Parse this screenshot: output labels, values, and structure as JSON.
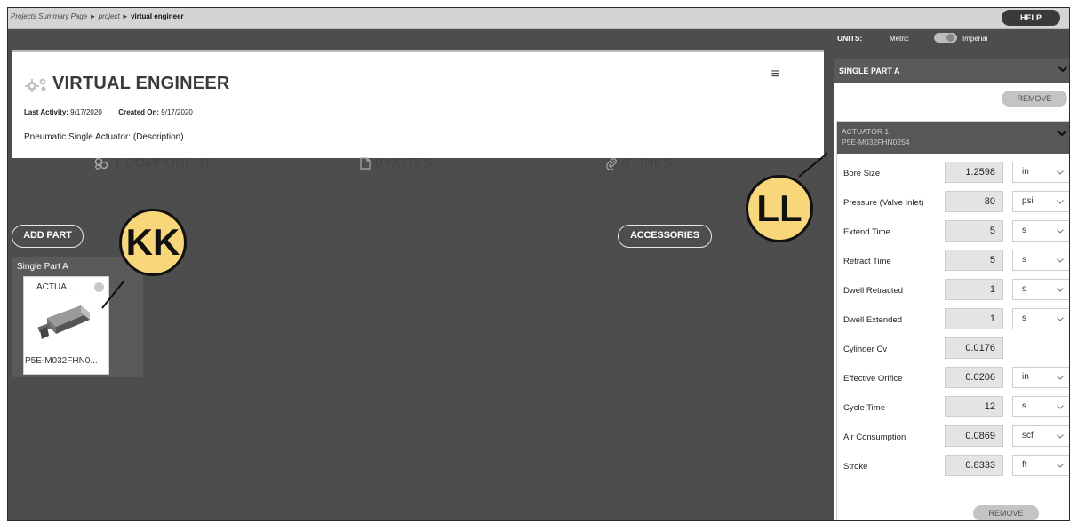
{
  "breadcrumb": {
    "link1": "Projects Summary Page",
    "sep": "►",
    "link2": "project",
    "current": "virtual engineer"
  },
  "help_label": "HELP",
  "project": {
    "title": "VIRTUAL ENGINEER",
    "last_activity_label": "Last Activity:",
    "last_activity": "9/17/2020",
    "created_label": "Created On:",
    "created": "9/17/2020",
    "description": "Pneumatic Single Actuator: (Description)",
    "components": "1 COMPONENT",
    "notes": "0 NOTES",
    "links": "0 LINKS",
    "menu_icon": "≡"
  },
  "buttons": {
    "add_part": "ADD PART",
    "accessories": "ACCESSORIES"
  },
  "part": {
    "name": "Single Part A",
    "component_name": "ACTUA...",
    "component_part": "P5E-M032FHN0..."
  },
  "callouts": {
    "kk": "KK",
    "ll": "LL"
  },
  "panel": {
    "units_label": "UNITS:",
    "metric": "Metric",
    "imperial": "Imperial",
    "single_part": "SINGLE PART A",
    "remove": "REMOVE",
    "actuator_title": "ACTUATOR 1",
    "actuator_part": "P5E-M032FHN0254",
    "properties": [
      {
        "label": "Bore Size",
        "value": "1.2598",
        "unit": "in"
      },
      {
        "label": "Pressure (Valve Inlet)",
        "value": "80",
        "unit": "psi"
      },
      {
        "label": "Extend Time",
        "value": "5",
        "unit": "s"
      },
      {
        "label": "Retract Time",
        "value": "5",
        "unit": "s"
      },
      {
        "label": "Dwell Retracted",
        "value": "1",
        "unit": "s"
      },
      {
        "label": "Dwell Extended",
        "value": "1",
        "unit": "s"
      },
      {
        "label": "Cylinder Cv",
        "value": "0.0176",
        "unit": ""
      },
      {
        "label": "Effective Orifice",
        "value": "0.0206",
        "unit": "in"
      },
      {
        "label": "Cycle Time",
        "value": "12",
        "unit": "s"
      },
      {
        "label": "Air Consumption",
        "value": "0.0869",
        "unit": "scf"
      },
      {
        "label": "Stroke",
        "value": "0.8333",
        "unit": "ft"
      }
    ]
  },
  "icons": {
    "gear": "gears-icon",
    "components": "components-icon",
    "notes": "note-icon",
    "links": "paperclip-icon",
    "chevron": "chevron-down-icon",
    "check": "check-circle-icon"
  },
  "colors": {
    "callout_fill": "#f7d77a",
    "dark_bg": "#4d4d4d",
    "panel_header": "#5a5a5a"
  }
}
